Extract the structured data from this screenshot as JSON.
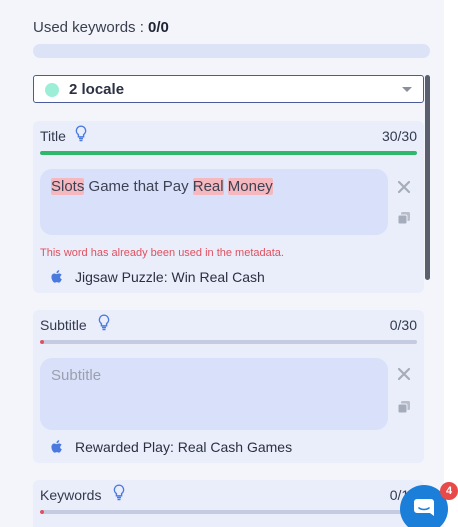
{
  "used_keywords": {
    "label": "Used keywords :",
    "value": "0/0"
  },
  "locale_select": {
    "value": "2 locale",
    "dot_color": "#9deed6"
  },
  "title_section": {
    "label": "Title",
    "counter": "30/30",
    "progress_fraction": 1.0,
    "progress_color": "#2db86a",
    "field_segments": [
      "Slots",
      " Game that Pay ",
      "Real",
      " ",
      "Money"
    ],
    "highlighted_words": [
      "Slots",
      "Real",
      "Money"
    ],
    "error": "This word has already been used in the metadata.",
    "suggestion": "Jigsaw Puzzle: Win Real Cash"
  },
  "subtitle_section": {
    "label": "Subtitle",
    "counter": "0/30",
    "progress_fraction": 0.0,
    "progress_color": "#e0505f",
    "placeholder": "Subtitle",
    "suggestion": "Rewarded Play: Real Cash Games"
  },
  "keywords_section": {
    "label": "Keywords",
    "counter": "0/10",
    "progress_fraction": 0.0,
    "progress_color": "#e0505f"
  },
  "chat": {
    "badge_count": "4",
    "color": "#1b7fd9"
  },
  "icons": [
    "lightbulb-icon",
    "close-icon",
    "copy-icon",
    "apple-icon",
    "chat-icon",
    "chevron-down-icon"
  ]
}
